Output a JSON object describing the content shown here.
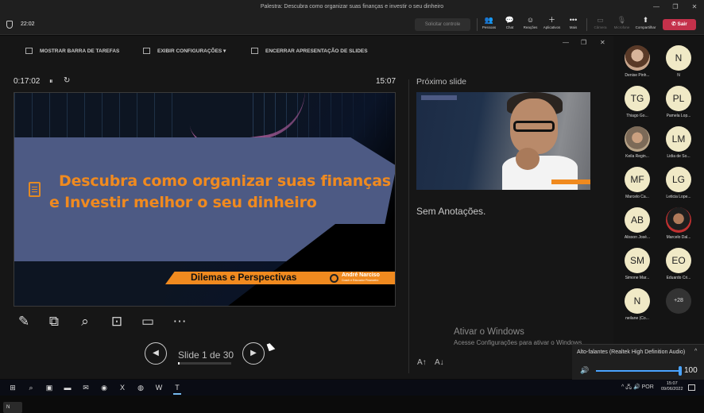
{
  "window": {
    "title": "Palestra: Descubra como organizar suas finanças e investir o seu dinheiro",
    "controls": [
      "—",
      "❐",
      "✕"
    ]
  },
  "meeting_bar": {
    "timer": "22:02",
    "request_control": "Solicitar controle",
    "buttons": [
      {
        "icon": "people-icon",
        "glyph": "👥",
        "label": "Pessoas"
      },
      {
        "icon": "chat-icon",
        "glyph": "💬",
        "label": "Chat"
      },
      {
        "icon": "reactions-icon",
        "glyph": "☺",
        "label": "Reações"
      },
      {
        "icon": "apps-icon",
        "glyph": "＋",
        "label": "Aplicativos"
      },
      {
        "icon": "more-icon",
        "glyph": "•••",
        "label": "Mais"
      },
      {
        "icon": "camera-icon",
        "glyph": "▭",
        "label": "Câmera"
      },
      {
        "icon": "mic-icon",
        "glyph": "🎙",
        "label": "Microfone"
      },
      {
        "icon": "share-icon",
        "glyph": "⬆",
        "label": "Compartilhar"
      }
    ],
    "leave_label": "Sair",
    "leave_glyph": "✆"
  },
  "presenter": {
    "top_actions": [
      "MOSTRAR BARRA DE TAREFAS",
      "EXIBIR CONFIGURAÇÕES ▾",
      "ENCERRAR APRESENTAÇÃO DE SLIDES"
    ],
    "window_glyphs": [
      "—",
      "❐",
      "✕"
    ],
    "elapsed": "0:17:02",
    "clock": "15:07",
    "pause_glyph": "⏸",
    "restart_glyph": "↻",
    "current_slide": {
      "headline_line1": "Descubra como organizar suas finanças",
      "headline_line2": "e Investir melhor o seu dinheiro",
      "subtitle": "Dilemas e Perspectivas",
      "brand": "André Narciso",
      "brand_tagline": "Coach e Educador Financeiro"
    },
    "tools": [
      {
        "name": "pen-icon",
        "glyph": "✎"
      },
      {
        "name": "see-all-slides-icon",
        "glyph": "⧉"
      },
      {
        "name": "zoom-icon",
        "glyph": "⌕"
      },
      {
        "name": "black-screen-icon",
        "glyph": "⊡"
      },
      {
        "name": "subtitles-icon",
        "glyph": "▭"
      },
      {
        "name": "more-options-icon",
        "glyph": "⋯"
      }
    ],
    "prev_glyph": "◀",
    "next_glyph": "▶",
    "slide_counter": "Slide 1 de 30",
    "progress": 0.033,
    "next_slide_label": "Próximo slide",
    "notes": "Sem Anotações.",
    "watermark_title": "Ativar o Windows",
    "watermark_sub": "Acesse Configurações para ativar o Windows.",
    "font_up": "A↑",
    "font_down": "A↓",
    "self_chip": "N"
  },
  "participants": [
    {
      "name": "Denise Pinh...",
      "initials": "",
      "photo": 1
    },
    {
      "name": "N",
      "initials": "N"
    },
    {
      "name": "Thiago Go...",
      "initials": "TG"
    },
    {
      "name": "Pamela Lop...",
      "initials": "PL"
    },
    {
      "name": "Keila Regin...",
      "initials": "",
      "photo": 2
    },
    {
      "name": "Lidia de So...",
      "initials": "LM"
    },
    {
      "name": "Marcelo Ca...",
      "initials": "MF"
    },
    {
      "name": "Leticia Lope...",
      "initials": "LG"
    },
    {
      "name": "Alisson José...",
      "initials": "AB"
    },
    {
      "name": "Marcelo Dal...",
      "initials": "",
      "photo": 3
    },
    {
      "name": "Simone Mar...",
      "initials": "SM"
    },
    {
      "name": "Eduardo Cri...",
      "initials": "EO"
    },
    {
      "name": "neilane (Co...",
      "initials": "N"
    },
    {
      "name": "",
      "initials": "+28",
      "more": true
    }
  ],
  "volume": {
    "device": "Alto-falantes (Realtek High Definition Audio)",
    "value": 100,
    "chevron": "^",
    "speaker_glyph": "🔊"
  },
  "taskbar": {
    "icons": [
      {
        "name": "start-icon",
        "glyph": "⊞"
      },
      {
        "name": "search-icon",
        "glyph": "⌕"
      },
      {
        "name": "task-view-icon",
        "glyph": "▣"
      },
      {
        "name": "file-explorer-icon",
        "glyph": "▬"
      },
      {
        "name": "mail-icon",
        "glyph": "✉"
      },
      {
        "name": "chrome-icon",
        "glyph": "◉"
      },
      {
        "name": "excel-icon",
        "glyph": "X"
      },
      {
        "name": "browser-icon",
        "glyph": "◍"
      },
      {
        "name": "word-icon",
        "glyph": "W"
      },
      {
        "name": "teams-icon",
        "glyph": "T"
      }
    ],
    "tray": "^ 🖧 🔊 POR",
    "time": "15:07",
    "date": "09/06/2022"
  },
  "colors": {
    "accent_orange": "#f08a1f",
    "slide_blue": "#4d5a84",
    "leave_red": "#c4314b"
  }
}
